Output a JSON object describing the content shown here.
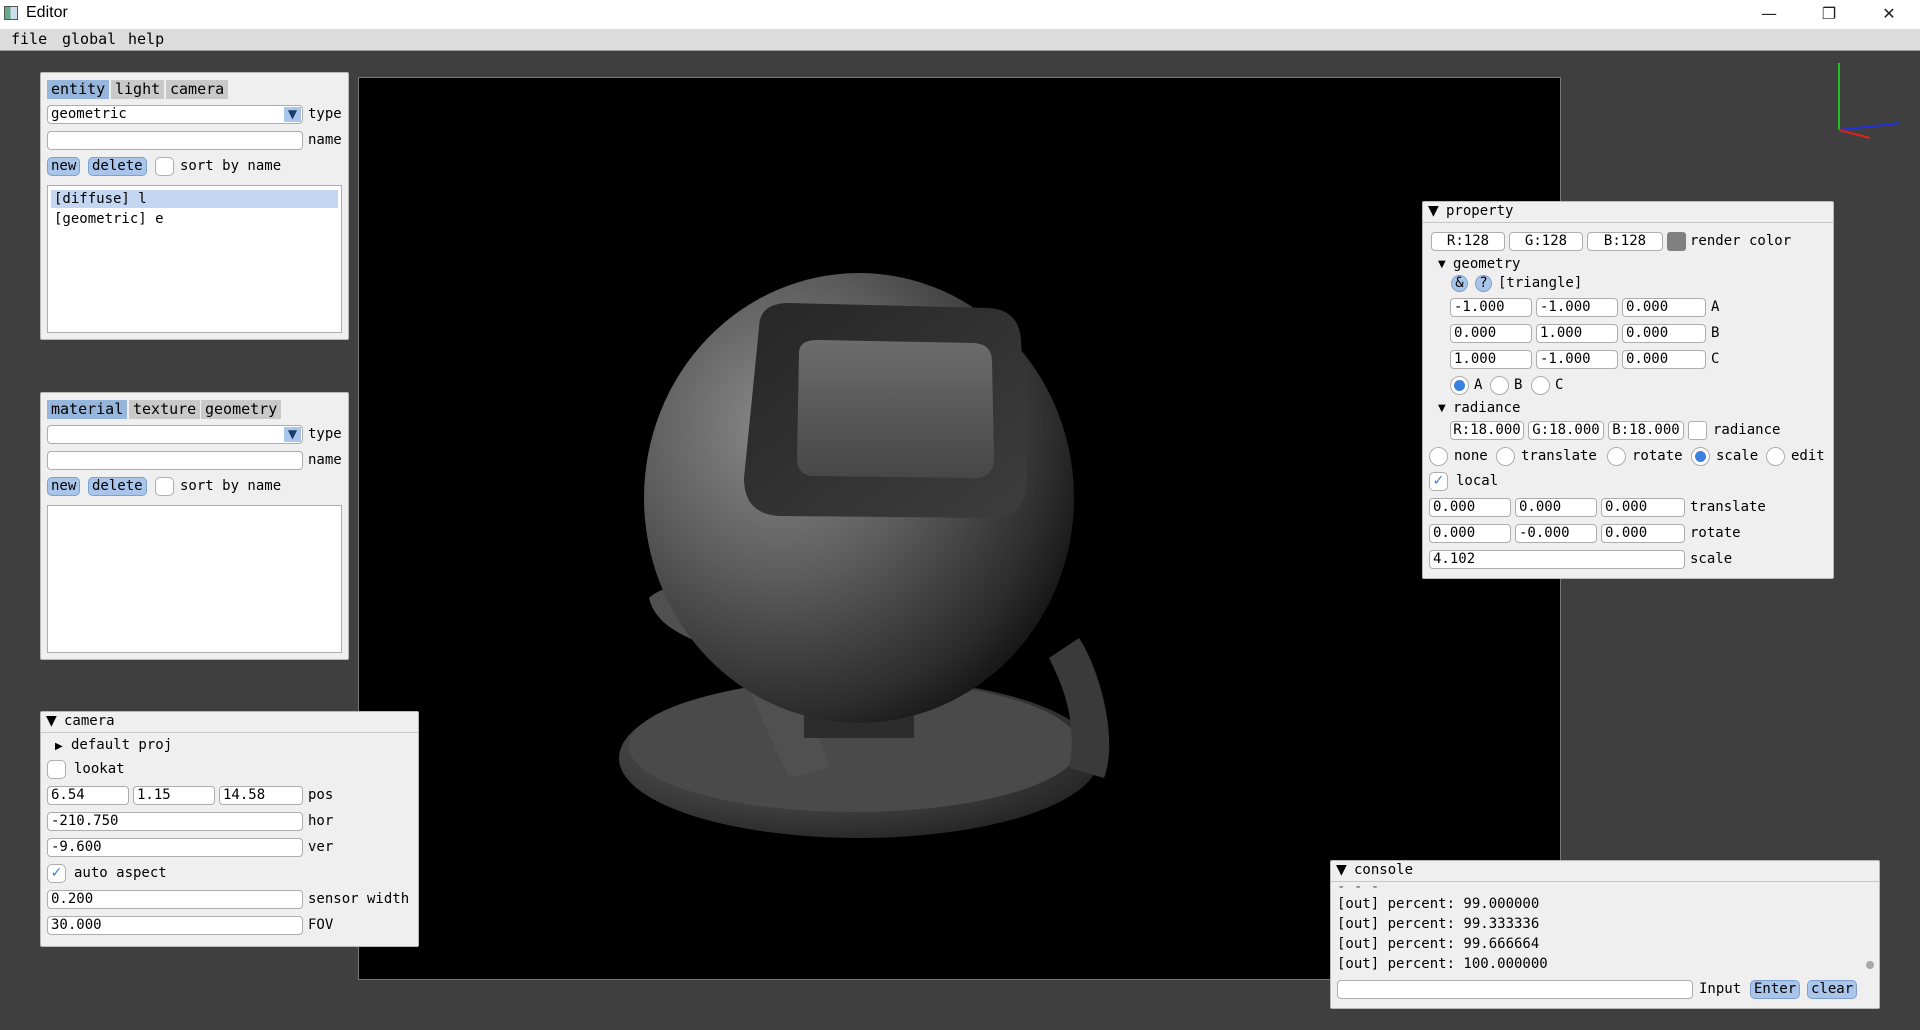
{
  "window": {
    "title": "Editor",
    "minimize_icon": "minimize-icon",
    "restore_icon": "restore-icon",
    "close_icon": "close-icon"
  },
  "menu": {
    "items": [
      "file",
      "global",
      "help"
    ]
  },
  "entity_panel": {
    "tabs": [
      "entity",
      "light",
      "camera"
    ],
    "active_tab": "entity",
    "type_value": "geometric",
    "type_label": "type",
    "name_value": "",
    "name_label": "name",
    "new_label": "new",
    "delete_label": "delete",
    "sort_label": "sort by name",
    "items": [
      "[diffuse] l",
      "[geometric] e"
    ],
    "selected_index": 0
  },
  "material_panel": {
    "tabs": [
      "material",
      "texture",
      "geometry"
    ],
    "active_tab": "material",
    "type_value": "",
    "type_label": "type",
    "name_value": "",
    "name_label": "name",
    "new_label": "new",
    "delete_label": "delete",
    "sort_label": "sort by name",
    "items": []
  },
  "camera_panel": {
    "title": "camera",
    "default_proj": "default proj",
    "lookat_label": "lookat",
    "lookat_checked": false,
    "pos": [
      "6.54",
      "1.15",
      "14.58"
    ],
    "pos_label": "pos",
    "hor": "-210.750",
    "hor_label": "hor",
    "ver": "-9.600",
    "ver_label": "ver",
    "auto_aspect_label": "auto aspect",
    "auto_aspect_checked": true,
    "sensor_width": "0.200",
    "sensor_width_label": "sensor width",
    "fov": "30.000",
    "fov_label": "FOV"
  },
  "property_panel": {
    "title": "property",
    "render_color": {
      "r": "R:128",
      "g": "G:128",
      "b": "B:128",
      "label": "render color",
      "swatch": "#808080"
    },
    "geometry": {
      "title": "geometry",
      "amp_label": "&",
      "help_label": "?",
      "shape_label": "[triangle]",
      "A": [
        "-1.000",
        "-1.000",
        "0.000"
      ],
      "B": [
        "0.000",
        "1.000",
        "0.000"
      ],
      "C": [
        "1.000",
        "-1.000",
        "0.000"
      ],
      "vertex_labels": [
        "A",
        "B",
        "C"
      ],
      "selected_vertex": "A"
    },
    "radiance": {
      "title": "radiance",
      "r": "R:18.000",
      "g": "G:18.000",
      "b": "B:18.000",
      "label": "radiance"
    },
    "transform_modes": [
      "none",
      "translate",
      "rotate",
      "scale",
      "edit"
    ],
    "selected_mode": "scale",
    "local_label": "local",
    "local_checked": true,
    "translate": [
      "0.000",
      "0.000",
      "0.000"
    ],
    "translate_label": "translate",
    "rotate": [
      "0.000",
      "-0.000",
      "0.000"
    ],
    "rotate_label": "rotate",
    "scale": "4.102",
    "scale_label": "scale"
  },
  "console": {
    "title": "console",
    "lines": [
      "[out] percent: 99.000000",
      "[out] percent: 99.333336",
      "[out] percent: 99.666664",
      "[out] percent: 100.000000"
    ],
    "input_value": "",
    "input_label": "Input",
    "enter_label": "Enter",
    "clear_label": "clear"
  },
  "gizmo": {
    "x_color": "#e02020",
    "y_color": "#20c020",
    "z_color": "#2030e0"
  },
  "viewport": {
    "background": "#000000",
    "object": "rendered-helmet-model"
  }
}
